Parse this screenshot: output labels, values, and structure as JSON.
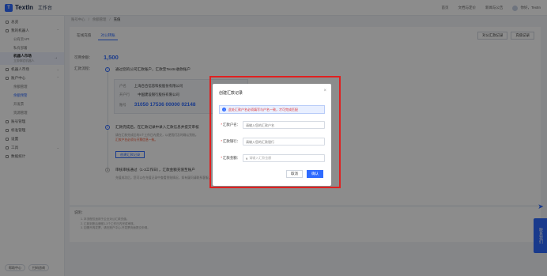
{
  "app": {
    "logo": "TextIn",
    "workspace": "工作台"
  },
  "top": {
    "links": [
      "首页",
      "文档与定价",
      "新闻与公告"
    ],
    "user": "你好，TextIn"
  },
  "sidebar": {
    "items": [
      {
        "label": "总览"
      },
      {
        "label": "我的机器人"
      },
      {
        "label": "公有云API"
      },
      {
        "label": "私有部署"
      },
      {
        "label": "机器人市场"
      },
      {
        "label": "账户中心"
      },
      {
        "label": "余额管理"
      },
      {
        "label": "余额预警"
      },
      {
        "label": "开发票"
      },
      {
        "label": "资源管理"
      },
      {
        "label": "账号管理"
      },
      {
        "label": "标准管理"
      },
      {
        "label": "设置"
      },
      {
        "label": "工具"
      },
      {
        "label": "数据统计"
      }
    ],
    "active": {
      "title": "机器人市场",
      "subtitle": "立即体验机器人"
    },
    "bottom": [
      "帮助中心",
      "扫码咨询"
    ]
  },
  "breadcrumb": [
    "账号中心",
    "余额管理",
    "充值"
  ],
  "panel": {
    "tabs": [
      "在线充值",
      "对公转账"
    ],
    "buttons": [
      "对公汇款记录",
      "充值记录"
    ],
    "balance_label": "可用余额：",
    "balance_value": "1,500",
    "method_label": "汇款流程：",
    "step1": "通过您的公司汇款账户，汇款至TextIn收款账户",
    "acct_name_label": "户名",
    "acct_name": "上海合合信息科技股份有限公司",
    "acct_bank_label": "开户行",
    "acct_bank": "中国建设银行股份有限公司",
    "acct_no_label": "账号",
    "acct_no": "31050 17536 00000 02148",
    "step2": "汇款完成后，在汇款记录中录入汇款信息并提交审核",
    "step2_desc": "请在汇款完成后的3个工作日内提交，以便我们及时确认到账。",
    "step2_red": "汇款户名必须与开票信息一致。",
    "step2_btn": "创建汇款记录",
    "step3": "审核审核通过（1-3工作日），汇款金额充值至账户",
    "step3_desc": "充值成功后，您可以在充值记录中查看到账情况，如有疑问请联系客服。"
  },
  "notes": {
    "title": "说明：",
    "items": [
      "1. 本流程仅适用于企业对公汇款充值。",
      "2. 汇款到账后通常1-3个工作日内完成审核。",
      "3. 如需开具发票，请在账户中心-开发票页面提交申请。"
    ]
  },
  "float": {
    "label": "联系我们"
  },
  "modal": {
    "title": "创建汇款记录",
    "alert_pre": "",
    "alert_red": "此处汇款户名必须填写与户名一致，才可完成匹配",
    "fields": [
      {
        "label": "汇款户名：",
        "placeholder": "请输入您的汇款户名"
      },
      {
        "label": "汇款银行：",
        "placeholder": "请输入您的汇款银行"
      },
      {
        "label": "汇款金额：",
        "placeholder": "请输入汇款金额",
        "prefix": "¥"
      }
    ],
    "cancel": "取消",
    "ok": "确认"
  }
}
